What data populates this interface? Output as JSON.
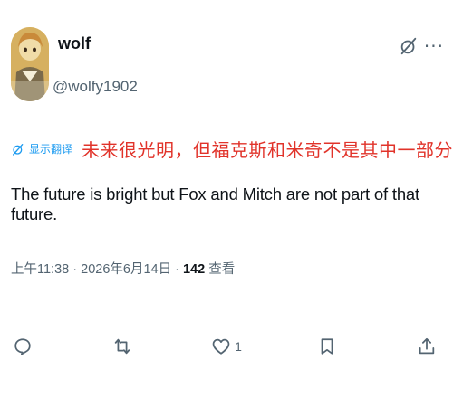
{
  "author": {
    "display_name": "wolf",
    "handle": "@wolfy1902"
  },
  "translation": {
    "link_label": "显示翻译",
    "original_text": "未来很光明，但福克斯和米奇不是其中一部分"
  },
  "post": {
    "text": "The future is bright but Fox and Mitch are not part of that future."
  },
  "meta": {
    "time": "上午11:38",
    "separator": "·",
    "date": "2026年6月14日",
    "views_count": "142",
    "views_label": "查看"
  },
  "actions": {
    "reply_count": "",
    "repost_count": "",
    "like_count": "1",
    "bookmark_count": "",
    "share_count": ""
  },
  "icons": {
    "grok": "grok-icon",
    "more": "more-icon",
    "translate": "translate-icon",
    "reply": "reply-icon",
    "repost": "repost-icon",
    "like": "heart-icon",
    "bookmark": "bookmark-icon",
    "share": "share-icon"
  },
  "colors": {
    "text": "#0f1419",
    "secondary": "#536471",
    "link": "#1d9bf0",
    "original_text": "#e1332a"
  }
}
